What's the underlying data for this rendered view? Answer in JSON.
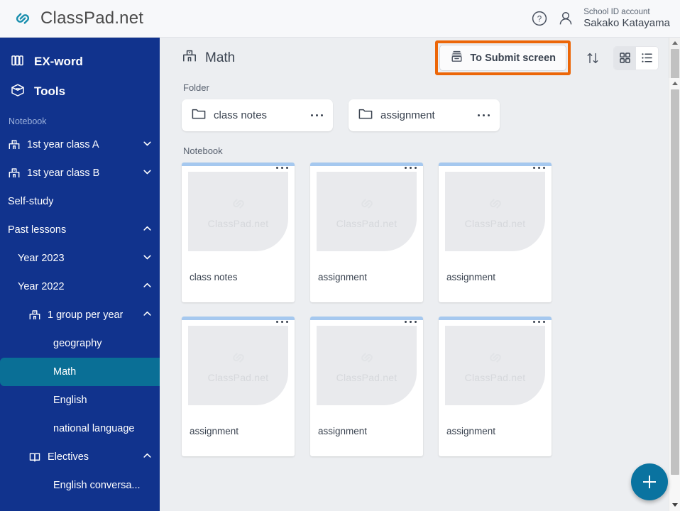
{
  "app": {
    "brand": "ClassPad.net",
    "brand_icon": "chain-link-icon",
    "accent_teal": "#0a73a0",
    "sidebar_blue": "#11338d",
    "highlight_orange": "#ec6608"
  },
  "topbar": {
    "help_icon": "help-circle-icon",
    "person_icon": "person-icon",
    "account_label": "School ID account",
    "account_name": "Sakako Katayama"
  },
  "sidebar": {
    "top_items": [
      {
        "label": "EX-word",
        "icon": "books-icon"
      },
      {
        "label": "Tools",
        "icon": "box-icon"
      }
    ],
    "section_label": "Notebook",
    "items": [
      {
        "label": "1st year class A",
        "icon": "school-icon",
        "indent": 0,
        "chevron": "down",
        "selected": false
      },
      {
        "label": "1st year class B",
        "icon": "school-icon",
        "indent": 0,
        "chevron": "down",
        "selected": false
      },
      {
        "label": "Self-study",
        "icon": "none",
        "indent": 0,
        "chevron": "none",
        "selected": false
      },
      {
        "label": "Past lessons",
        "icon": "none",
        "indent": 0,
        "chevron": "up",
        "selected": false
      },
      {
        "label": "Year 2023",
        "icon": "none",
        "indent": 1,
        "chevron": "down",
        "selected": false
      },
      {
        "label": "Year 2022",
        "icon": "none",
        "indent": 1,
        "chevron": "up",
        "selected": false
      },
      {
        "label": "1 group per year",
        "icon": "school-icon",
        "indent": 2,
        "chevron": "up",
        "selected": false
      },
      {
        "label": "geography",
        "icon": "none",
        "indent": 3,
        "chevron": "none",
        "selected": false
      },
      {
        "label": "Math",
        "icon": "none",
        "indent": 3,
        "chevron": "none",
        "selected": true
      },
      {
        "label": "English",
        "icon": "none",
        "indent": 3,
        "chevron": "none",
        "selected": false
      },
      {
        "label": "national language",
        "icon": "none",
        "indent": 3,
        "chevron": "none",
        "selected": false
      },
      {
        "label": "Electives",
        "icon": "open-book-icon",
        "indent": 2,
        "chevron": "up",
        "selected": false
      },
      {
        "label": "English conversa...",
        "icon": "none",
        "indent": 3,
        "chevron": "none",
        "selected": false
      }
    ]
  },
  "content": {
    "page_icon": "school-icon",
    "page_title": "Math",
    "submit_button": {
      "label": "To Submit screen",
      "icon": "inbox-tray-icon",
      "highlighted": true
    },
    "sort_icon": "sort-arrows-icon",
    "view_toggle": {
      "grid_icon": "grid-view-icon",
      "list_icon": "list-view-icon",
      "active": "grid"
    },
    "folder_section_label": "Folder",
    "folders": [
      {
        "name": "class notes",
        "icon": "folder-icon",
        "menu": "more-options-icon"
      },
      {
        "name": "assignment",
        "icon": "folder-icon",
        "menu": "more-options-icon"
      }
    ],
    "notebook_section_label": "Notebook",
    "notebook_watermark": "ClassPad.net",
    "notebooks": [
      {
        "name": "class notes"
      },
      {
        "name": "assignment"
      },
      {
        "name": "assignment"
      },
      {
        "name": "assignment"
      },
      {
        "name": "assignment"
      },
      {
        "name": "assignment"
      }
    ],
    "fab": {
      "icon": "plus-icon",
      "label": "+"
    }
  }
}
